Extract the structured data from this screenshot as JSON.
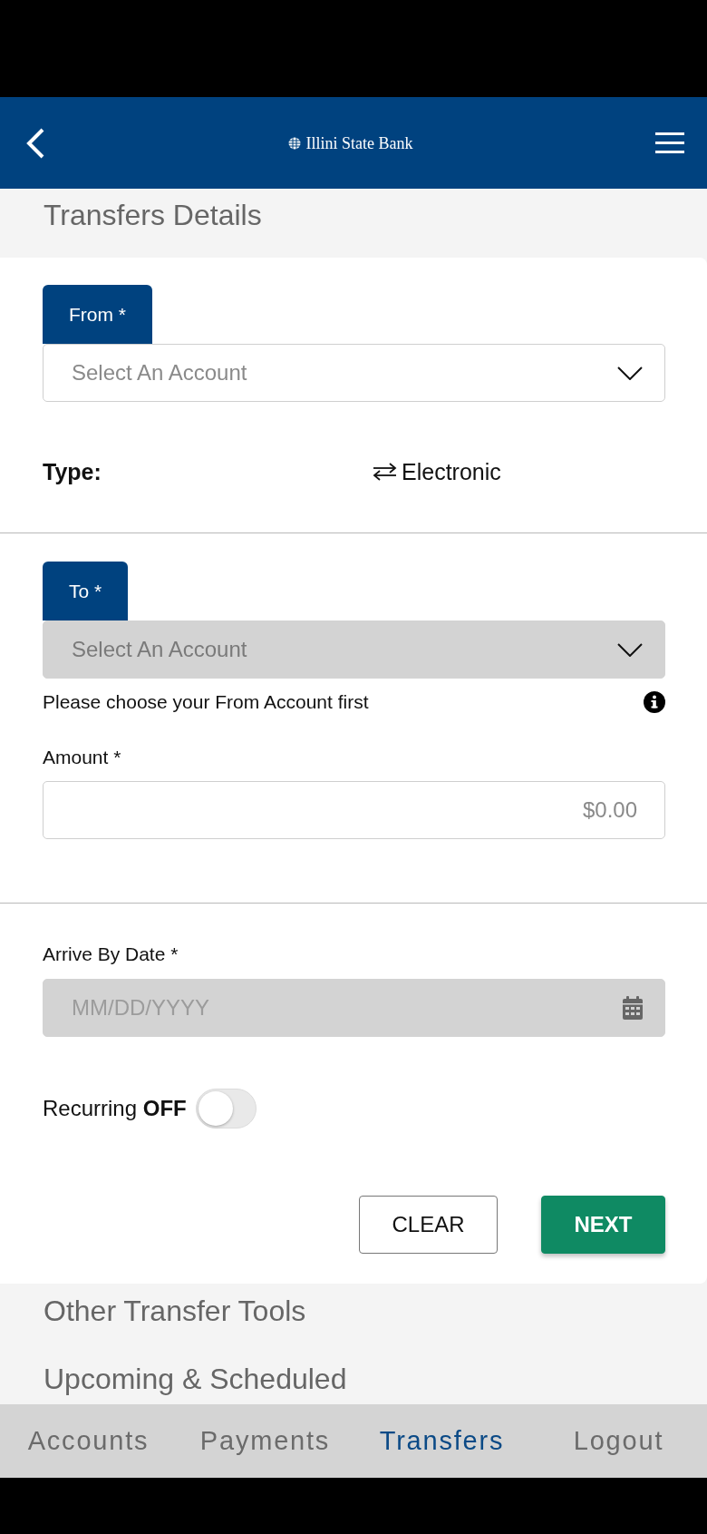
{
  "header": {
    "title": "Illini State Bank"
  },
  "page_title": "Transfers Details",
  "from": {
    "tab_label": "From *",
    "select": {
      "placeholder": "Select An Account",
      "disabled": false
    }
  },
  "type": {
    "label": "Type:",
    "value": "Electronic"
  },
  "to": {
    "tab_label": "To *",
    "select": {
      "placeholder": "Select An Account",
      "disabled": true
    },
    "help_text": "Please choose your From Account first"
  },
  "amount": {
    "label": "Amount *",
    "placeholder": "$0.00"
  },
  "arrive_by_date": {
    "label": "Arrive By Date *",
    "placeholder": "MM/DD/YYYY",
    "disabled": true
  },
  "recurring": {
    "label": "Recurring **OFF**",
    "on": false
  },
  "buttons": [
    {
      "label": "CLEAR",
      "kind": "secondary"
    },
    {
      "label": "NEXT",
      "kind": "primary"
    }
  ],
  "sections": [
    "Other Transfer Tools",
    "Upcoming & Scheduled"
  ],
  "bottom_nav": [
    {
      "label": "Accounts",
      "selected": false
    },
    {
      "label": "Payments",
      "selected": false
    },
    {
      "label": "Transfers",
      "selected": true
    },
    {
      "label": "Logout",
      "selected": false
    }
  ]
}
